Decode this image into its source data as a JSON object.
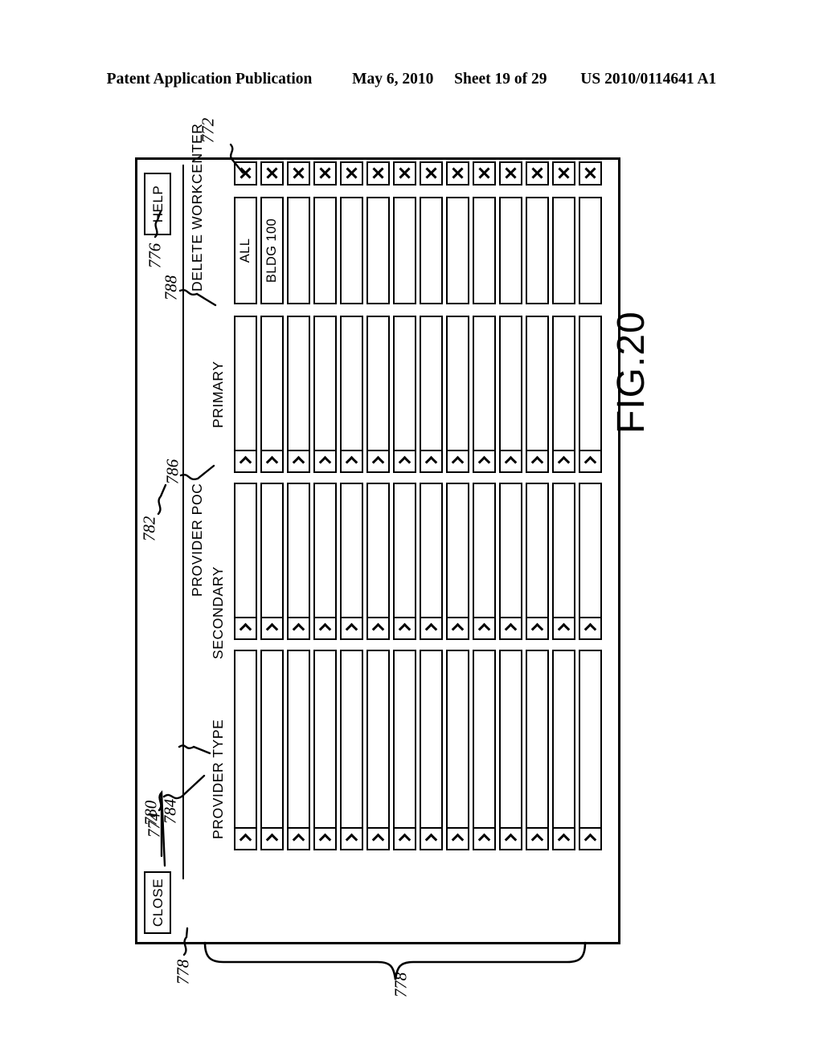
{
  "publication_header": {
    "left": "Patent Application Publication",
    "date": "May 6, 2010",
    "sheet": "Sheet 19 of 29",
    "number": "US 2010/0114641 A1"
  },
  "figure": {
    "label": "FIG.20",
    "reference_numerals": {
      "dialog_window": "772",
      "help_button": "774",
      "close_button": "776",
      "row_group_left": "778",
      "row_group_bottom": "778",
      "workcenter_column": "780",
      "provider_poc_group": "782",
      "workcenter_field": "784",
      "secondary_select": "786",
      "provider_type_select": "788"
    }
  },
  "dialog": {
    "toolbar": {
      "close_label": "CLOSE",
      "help_label": "HELP"
    },
    "column_headers": {
      "delete_workcenter": "DELETE WORKCENTER",
      "provider_poc": "PROVIDER POC",
      "primary": "PRIMARY",
      "secondary": "SECONDARY",
      "provider_type": "PROVIDER TYPE"
    },
    "table": {
      "columns": [
        "DELETE WORKCENTER",
        "WORKCENTER",
        "PRIMARY",
        "SECONDARY",
        "PROVIDER TYPE"
      ],
      "delete_icon": "x-icon",
      "dropdown_icon": "chevron-down-icon",
      "rows": [
        {
          "workcenter": "ALL",
          "primary": "",
          "secondary": "",
          "provider_type": ""
        },
        {
          "workcenter": "BLDG 100",
          "primary": "",
          "secondary": "",
          "provider_type": ""
        },
        {
          "workcenter": "",
          "primary": "",
          "secondary": "",
          "provider_type": ""
        },
        {
          "workcenter": "",
          "primary": "",
          "secondary": "",
          "provider_type": ""
        },
        {
          "workcenter": "",
          "primary": "",
          "secondary": "",
          "provider_type": ""
        },
        {
          "workcenter": "",
          "primary": "",
          "secondary": "",
          "provider_type": ""
        },
        {
          "workcenter": "",
          "primary": "",
          "secondary": "",
          "provider_type": ""
        },
        {
          "workcenter": "",
          "primary": "",
          "secondary": "",
          "provider_type": ""
        },
        {
          "workcenter": "",
          "primary": "",
          "secondary": "",
          "provider_type": ""
        },
        {
          "workcenter": "",
          "primary": "",
          "secondary": "",
          "provider_type": ""
        },
        {
          "workcenter": "",
          "primary": "",
          "secondary": "",
          "provider_type": ""
        },
        {
          "workcenter": "",
          "primary": "",
          "secondary": "",
          "provider_type": ""
        },
        {
          "workcenter": "",
          "primary": "",
          "secondary": "",
          "provider_type": ""
        },
        {
          "workcenter": "",
          "primary": "",
          "secondary": "",
          "provider_type": ""
        }
      ]
    }
  }
}
